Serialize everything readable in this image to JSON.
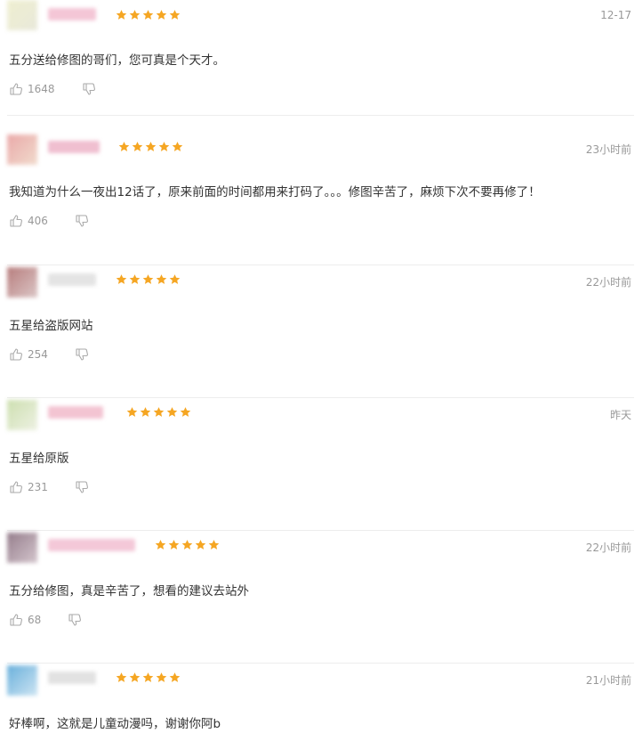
{
  "accent_color": "#f5a623",
  "comments": [
    {
      "time": "12-17",
      "text": "五分送给修图的哥们，您可真是个天才。",
      "likes": "1648",
      "rating": 5,
      "avatar_colors": [
        "#eeeecc",
        "#e6e6d6"
      ],
      "name_color": "#f4c6d6"
    },
    {
      "time": "23小时前",
      "text": "我知道为什么一夜出12话了，原来前面的时间都用来打码了。。。修图辛苦了，麻烦下次不要再修了！",
      "likes": "406",
      "rating": 5,
      "avatar_colors": [
        "#e8a0a0",
        "#f0d8c8"
      ],
      "name_color": "#f0bfd0"
    },
    {
      "time": "22小时前",
      "text": "五星给盗版网站",
      "likes": "254",
      "rating": 5,
      "avatar_colors": [
        "#b07070",
        "#d8c0c0"
      ],
      "name_color": "#e4e4e4"
    },
    {
      "time": "昨天",
      "text": "五星给原版",
      "likes": "231",
      "rating": 5,
      "avatar_colors": [
        "#c8dca8",
        "#ecf0e0"
      ],
      "name_color": "#f3c4d2"
    },
    {
      "time": "22小时前",
      "text": "五分给修图，真是辛苦了，想看的建议去站外",
      "likes": "68",
      "rating": 5,
      "avatar_colors": [
        "#8a7080",
        "#d0c0c8"
      ],
      "name_color": "#f4c8d8"
    },
    {
      "time": "21小时前",
      "text": "好棒啊，这就是儿童动漫吗，谢谢你阿b",
      "likes": "",
      "rating": 5,
      "avatar_colors": [
        "#5aa8d8",
        "#c8e2f2"
      ],
      "name_color": "#e2e2e2"
    }
  ]
}
